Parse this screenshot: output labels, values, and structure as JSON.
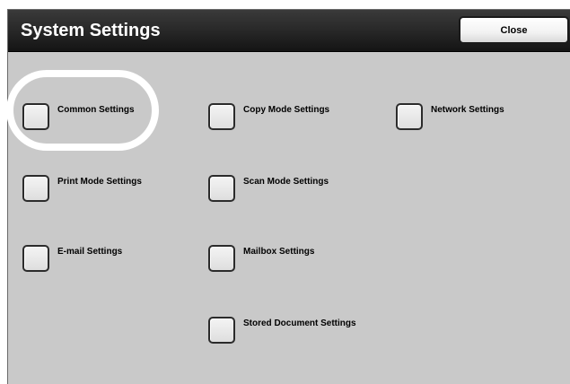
{
  "header": {
    "title": "System Settings",
    "close_label": "Close"
  },
  "options": [
    {
      "id": "common",
      "label": "Common Settings",
      "highlighted": true
    },
    {
      "id": "copy-mode",
      "label": "Copy Mode Settings"
    },
    {
      "id": "network",
      "label": "Network Settings"
    },
    {
      "id": "print-mode",
      "label": "Print Mode Settings"
    },
    {
      "id": "scan-mode",
      "label": "Scan Mode Settings"
    },
    {
      "id": "email",
      "label": "E-mail Settings"
    },
    {
      "id": "mailbox",
      "label": "Mailbox Settings"
    },
    {
      "id": "stored-document",
      "label": "Stored Document Settings"
    }
  ],
  "colors": {
    "title_bar": "#262626",
    "panel_background": "#c9c9c9",
    "highlight_ring": "#ffffff"
  }
}
